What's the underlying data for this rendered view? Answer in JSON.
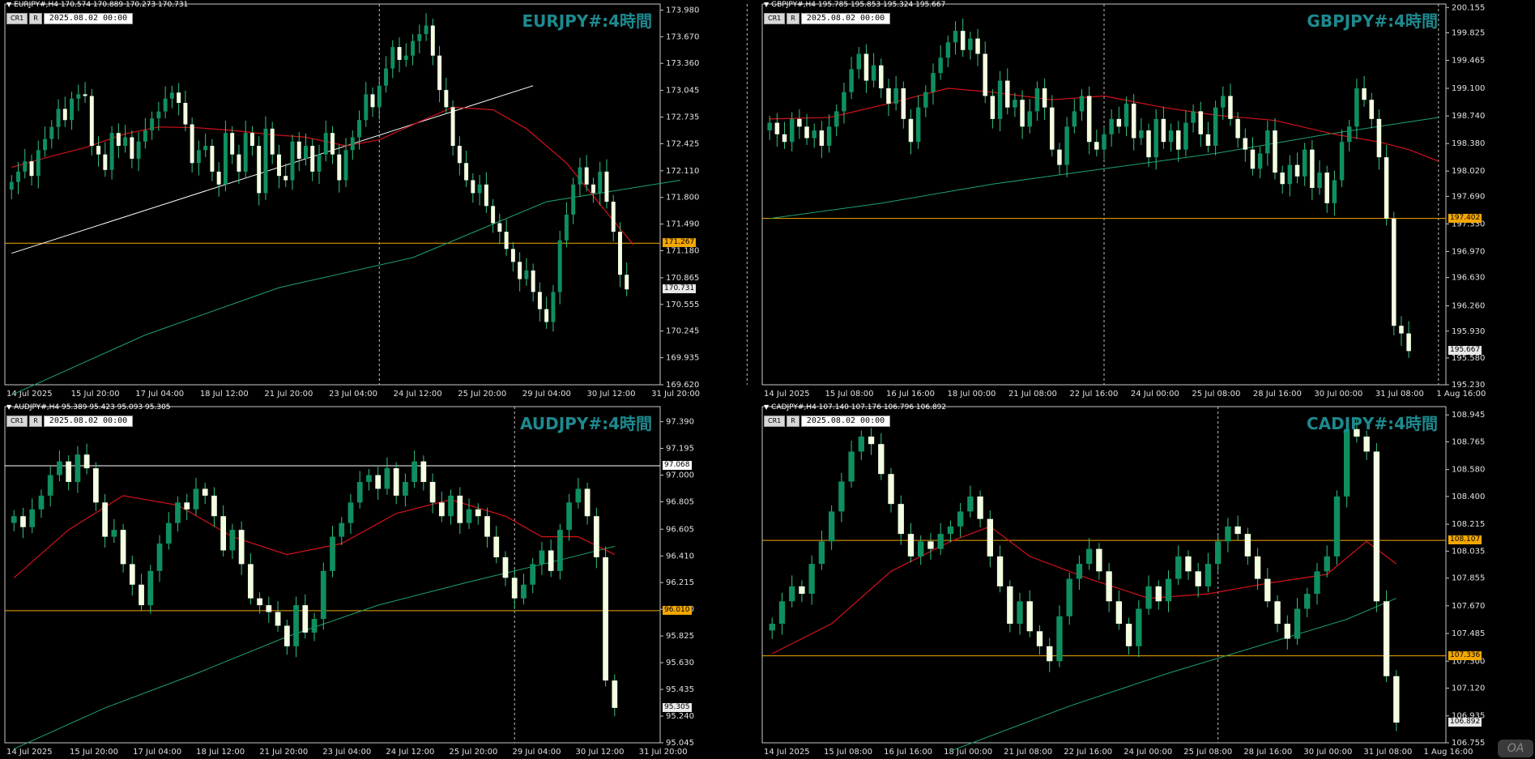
{
  "colors": {
    "bull": "#0f8f5f",
    "bear": "#f3ffe0",
    "wick": "#35c27f",
    "ma_fast": "#d3121b",
    "ma_slow": "#1fa36d",
    "hline": "#f4a700",
    "title": "#1d8a8f"
  },
  "toolbar": {
    "cr_label": "CR1",
    "r_label": "R",
    "datetime": "2025.08.02 00:00"
  },
  "watermark": "OA",
  "panels": [
    {
      "id": "eurjpy",
      "header": "EURJPY#,H4  170.574 170.889 170.273 170.731",
      "title": "EURJPY#:4時間",
      "chart_data": {
        "type": "candlestick",
        "ylim": [
          169.62,
          174.05
        ],
        "y_ticks": [
          "173.980",
          "173.670",
          "173.360",
          "173.045",
          "172.735",
          "172.425",
          "172.110",
          "171.800",
          "171.490",
          "171.180",
          "170.865",
          "170.555",
          "170.245",
          "169.935",
          "169.620"
        ],
        "x_ticks": [
          "14 Jul 2025",
          "15 Jul 20:00",
          "17 Jul 04:00",
          "18 Jul 12:00",
          "21 Jul 20:00",
          "23 Jul 04:00",
          "24 Jul 12:00",
          "25 Jul 20:00",
          "29 Jul 04:00",
          "30 Jul 12:00",
          "31 Jul 20:00"
        ],
        "close_price": "170.731",
        "hlines": [
          {
            "price": 171.267,
            "label": "171.267",
            "color": "#f4a700"
          }
        ],
        "trend_line": [
          [
            0,
            171.15
          ],
          [
            78,
            173.1
          ]
        ],
        "vlines": [
          55,
          110,
          165,
          233
        ],
        "closes": [
          171.98,
          172.1,
          172.22,
          172.05,
          172.35,
          172.48,
          172.62,
          172.83,
          172.7,
          172.95,
          173.0,
          172.98,
          172.4,
          172.3,
          172.12,
          172.55,
          172.4,
          172.5,
          172.25,
          172.45,
          172.58,
          172.72,
          172.8,
          172.95,
          173.02,
          172.9,
          172.65,
          172.2,
          172.35,
          172.4,
          172.1,
          171.95,
          172.55,
          172.3,
          172.1,
          172.55,
          172.4,
          171.85,
          172.6,
          172.3,
          172.05,
          172.0,
          172.45,
          172.25,
          172.4,
          172.1,
          172.3,
          172.55,
          172.3,
          172.0,
          172.35,
          172.5,
          172.7,
          173.0,
          172.85,
          173.1,
          173.3,
          173.55,
          173.4,
          173.45,
          173.62,
          173.7,
          173.8,
          173.45,
          173.05,
          172.85,
          172.4,
          172.2,
          172.0,
          171.85,
          171.95,
          171.7,
          171.5,
          171.4,
          171.2,
          171.05,
          170.85,
          170.95,
          170.7,
          170.5,
          170.35,
          170.7,
          171.3,
          171.6,
          171.95,
          172.15,
          171.95,
          171.85,
          172.1,
          171.75,
          171.4,
          170.9,
          170.73
        ],
        "ma_fast": [
          [
            0,
            172.15
          ],
          [
            6,
            172.28
          ],
          [
            11,
            172.38
          ],
          [
            17,
            172.54
          ],
          [
            22,
            172.62
          ],
          [
            28,
            172.61
          ],
          [
            33,
            172.58
          ],
          [
            39,
            172.53
          ],
          [
            44,
            172.5
          ],
          [
            50,
            172.4
          ],
          [
            55,
            172.47
          ],
          [
            61,
            172.68
          ],
          [
            66,
            172.85
          ],
          [
            72,
            172.82
          ],
          [
            77,
            172.6
          ],
          [
            83,
            172.2
          ],
          [
            88,
            171.72
          ],
          [
            93,
            171.25
          ]
        ],
        "ma_slow": [
          [
            0,
            169.5
          ],
          [
            20,
            170.2
          ],
          [
            40,
            170.75
          ],
          [
            60,
            171.1
          ],
          [
            80,
            171.75
          ],
          [
            100,
            172.0
          ]
        ]
      }
    },
    {
      "id": "gbpjpy",
      "header": "GBPJPY#,H4  195.785 195.853 195.324 195.667",
      "title": "GBPJPY#:4時間",
      "chart_data": {
        "type": "candlestick",
        "ylim": [
          195.23,
          200.2
        ],
        "y_ticks": [
          "200.155",
          "199.825",
          "199.465",
          "199.100",
          "198.740",
          "198.380",
          "198.020",
          "197.690",
          "197.330",
          "196.970",
          "196.630",
          "196.260",
          "195.930",
          "195.580",
          "195.230"
        ],
        "x_ticks": [
          "14 Jul 2025",
          "15 Jul 08:00",
          "16 Jul 16:00",
          "18 Jul 00:00",
          "21 Jul 08:00",
          "22 Jul 16:00",
          "24 Jul 00:00",
          "25 Jul 08:00",
          "28 Jul 16:00",
          "30 Jul 00:00",
          "31 Jul 08:00",
          "1 Aug 16:00"
        ],
        "close_price": "195.667",
        "hlines": [
          {
            "price": 197.402,
            "label": "197.402",
            "color": "#f4a700"
          }
        ],
        "vlines": [
          45,
          90,
          135,
          180
        ],
        "closes": [
          198.65,
          198.5,
          198.4,
          198.7,
          198.6,
          198.45,
          198.55,
          198.35,
          198.6,
          198.8,
          199.05,
          199.35,
          199.55,
          199.2,
          199.4,
          199.1,
          198.9,
          199.1,
          198.7,
          198.4,
          198.85,
          199.05,
          199.3,
          199.5,
          199.7,
          199.85,
          199.6,
          199.75,
          199.55,
          199.0,
          198.7,
          199.2,
          198.85,
          198.95,
          198.6,
          198.8,
          199.1,
          198.85,
          198.3,
          198.1,
          198.6,
          198.8,
          199.0,
          198.4,
          198.3,
          198.5,
          198.7,
          198.6,
          198.9,
          198.45,
          198.55,
          198.2,
          198.7,
          198.4,
          198.55,
          198.3,
          198.65,
          198.8,
          198.5,
          198.35,
          198.85,
          199.0,
          198.7,
          198.45,
          198.3,
          198.05,
          198.25,
          198.55,
          198.0,
          197.85,
          198.1,
          197.95,
          198.3,
          197.8,
          198.0,
          197.6,
          197.9,
          198.4,
          198.6,
          199.1,
          198.95,
          198.7,
          198.2,
          197.4,
          196.0,
          195.9,
          195.67
        ],
        "ma_fast": [
          [
            0,
            198.7
          ],
          [
            8,
            198.72
          ],
          [
            16,
            198.9
          ],
          [
            24,
            199.1
          ],
          [
            30,
            199.05
          ],
          [
            38,
            198.95
          ],
          [
            45,
            199.0
          ],
          [
            53,
            198.85
          ],
          [
            60,
            198.75
          ],
          [
            68,
            198.68
          ],
          [
            76,
            198.5
          ],
          [
            82,
            198.4
          ],
          [
            86,
            198.3
          ],
          [
            90,
            198.15
          ]
        ],
        "ma_slow": [
          [
            0,
            197.4
          ],
          [
            15,
            197.6
          ],
          [
            30,
            197.85
          ],
          [
            45,
            198.05
          ],
          [
            60,
            198.25
          ],
          [
            75,
            198.5
          ],
          [
            90,
            198.72
          ]
        ]
      }
    },
    {
      "id": "audjpy",
      "header": "AUDJPY#,H4  95.389 95.423 95.093 95.305",
      "title": "AUDJPY#:4時間",
      "chart_data": {
        "type": "candlestick",
        "ylim": [
          95.045,
          97.5
        ],
        "y_ticks": [
          "97.390",
          "97.195",
          "97.000",
          "96.805",
          "96.605",
          "96.410",
          "96.215",
          "96.020",
          "95.825",
          "95.630",
          "95.435",
          "95.240",
          "95.045"
        ],
        "x_ticks": [
          "14 Jul 2025",
          "15 Jul 20:00",
          "17 Jul 04:00",
          "18 Jul 12:00",
          "21 Jul 20:00",
          "23 Jul 04:00",
          "24 Jul 12:00",
          "25 Jul 20:00",
          "29 Jul 04:00",
          "30 Jul 12:00",
          "31 Jul 20:00"
        ],
        "close_price": "95.305",
        "hlines": [
          {
            "price": 97.068,
            "label": "97.068",
            "color": "#ffffff"
          },
          {
            "price": 96.01,
            "label": "96.010",
            "color": "#f4a700"
          }
        ],
        "vlines": [
          55,
          110,
          165,
          233
        ],
        "closes": [
          96.7,
          96.62,
          96.75,
          96.85,
          97.0,
          97.1,
          96.95,
          97.15,
          97.05,
          96.8,
          96.55,
          96.6,
          96.35,
          96.2,
          96.05,
          96.3,
          96.5,
          96.65,
          96.8,
          96.75,
          96.9,
          96.85,
          96.7,
          96.45,
          96.6,
          96.35,
          96.1,
          96.05,
          96.0,
          95.9,
          95.75,
          96.05,
          95.85,
          95.95,
          96.3,
          96.55,
          96.65,
          96.8,
          96.95,
          97.0,
          96.9,
          97.05,
          96.85,
          96.95,
          97.1,
          96.95,
          96.8,
          96.7,
          96.85,
          96.65,
          96.75,
          96.7,
          96.55,
          96.4,
          96.25,
          96.1,
          96.2,
          96.35,
          96.45,
          96.3,
          96.6,
          96.8,
          96.9,
          96.7,
          96.4,
          95.5,
          95.3
        ],
        "ma_fast": [
          [
            0,
            96.25
          ],
          [
            6,
            96.6
          ],
          [
            12,
            96.85
          ],
          [
            18,
            96.78
          ],
          [
            24,
            96.55
          ],
          [
            30,
            96.42
          ],
          [
            36,
            96.5
          ],
          [
            42,
            96.72
          ],
          [
            48,
            96.82
          ],
          [
            54,
            96.7
          ],
          [
            58,
            96.55
          ],
          [
            62,
            96.55
          ],
          [
            66,
            96.42
          ]
        ],
        "ma_slow": [
          [
            0,
            95.0
          ],
          [
            10,
            95.3
          ],
          [
            20,
            95.55
          ],
          [
            30,
            95.82
          ],
          [
            40,
            96.05
          ],
          [
            50,
            96.22
          ],
          [
            60,
            96.38
          ],
          [
            66,
            96.48
          ]
        ]
      }
    },
    {
      "id": "cadjpy",
      "header": "CADJPY#,H4  107.140 107.176 106.796 106.892",
      "title": "CADJPY#:4時間",
      "chart_data": {
        "type": "candlestick",
        "ylim": [
          106.755,
          109.0
        ],
        "y_ticks": [
          "108.945",
          "108.765",
          "108.580",
          "108.400",
          "108.215",
          "108.035",
          "107.855",
          "107.670",
          "107.485",
          "107.300",
          "107.120",
          "106.935",
          "106.755"
        ],
        "x_ticks": [
          "14 Jul 2025",
          "15 Jul 08:00",
          "16 Jul 16:00",
          "18 Jul 00:00",
          "21 Jul 08:00",
          "22 Jul 16:00",
          "24 Jul 00:00",
          "25 Jul 08:00",
          "28 Jul 16:00",
          "30 Jul 00:00",
          "31 Jul 08:00",
          "1 Aug 16:00"
        ],
        "close_price": "106.892",
        "hlines": [
          {
            "price": 108.107,
            "label": "108.107",
            "color": "#f4a700"
          },
          {
            "price": 107.336,
            "label": "107.336",
            "color": "#f4a700"
          }
        ],
        "vlines": [
          45,
          90,
          135,
          180
        ],
        "closes": [
          107.55,
          107.7,
          107.8,
          107.75,
          107.95,
          108.1,
          108.3,
          108.5,
          108.7,
          108.8,
          108.75,
          108.55,
          108.35,
          108.15,
          108.0,
          108.1,
          108.05,
          108.15,
          108.2,
          108.3,
          108.4,
          108.25,
          108.0,
          107.8,
          107.55,
          107.7,
          107.5,
          107.4,
          107.3,
          107.6,
          107.85,
          107.95,
          108.05,
          107.9,
          107.7,
          107.55,
          107.4,
          107.65,
          107.8,
          107.7,
          107.85,
          108.0,
          107.9,
          107.8,
          107.95,
          108.1,
          108.2,
          108.15,
          108.0,
          107.85,
          107.7,
          107.55,
          107.45,
          107.65,
          107.75,
          107.9,
          108.0,
          108.4,
          108.85,
          108.8,
          108.7,
          107.7,
          107.2,
          106.89
        ],
        "ma_fast": [
          [
            0,
            107.35
          ],
          [
            6,
            107.55
          ],
          [
            12,
            107.9
          ],
          [
            18,
            108.1
          ],
          [
            22,
            108.2
          ],
          [
            26,
            108.0
          ],
          [
            32,
            107.85
          ],
          [
            38,
            107.72
          ],
          [
            44,
            107.75
          ],
          [
            50,
            107.82
          ],
          [
            56,
            107.88
          ],
          [
            60,
            108.1
          ],
          [
            63,
            107.95
          ]
        ],
        "ma_slow": [
          [
            18,
            106.7
          ],
          [
            30,
            107.0
          ],
          [
            40,
            107.22
          ],
          [
            50,
            107.42
          ],
          [
            58,
            107.58
          ],
          [
            63,
            107.72
          ]
        ]
      }
    }
  ]
}
